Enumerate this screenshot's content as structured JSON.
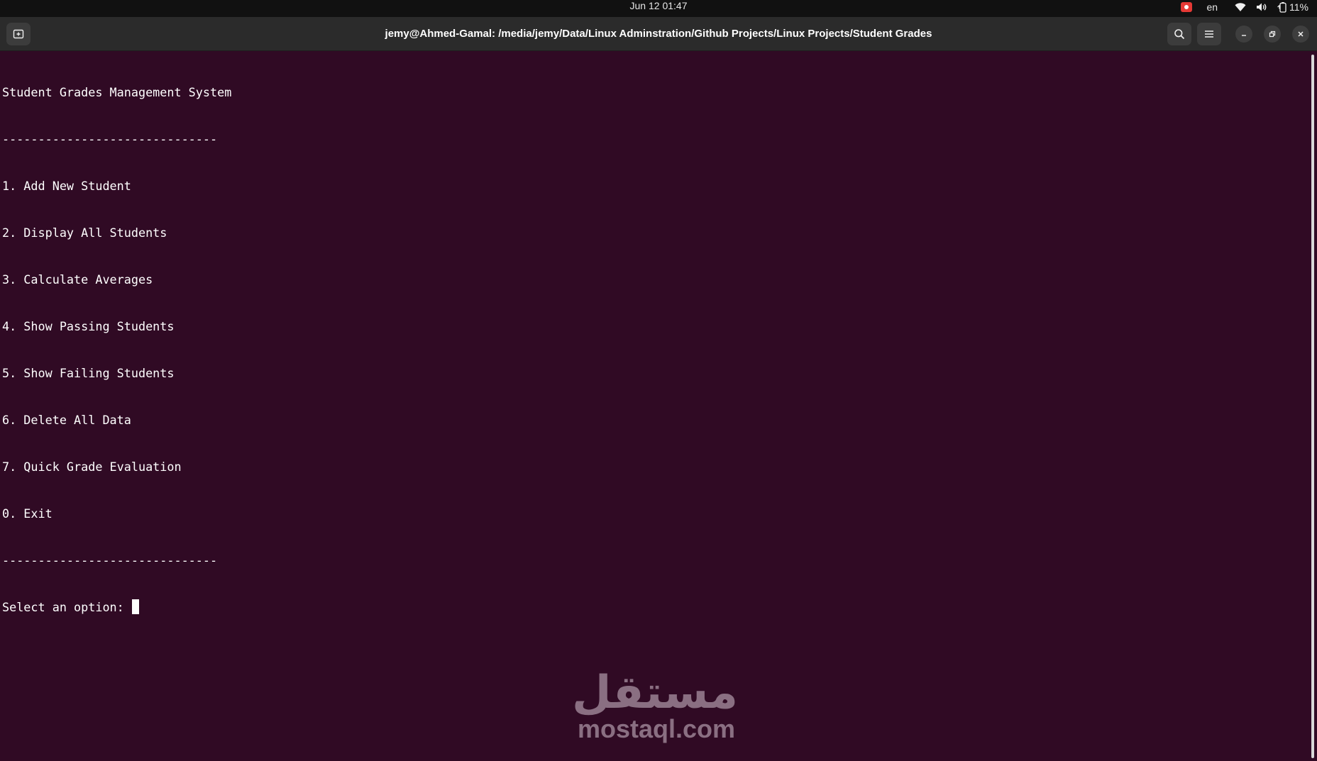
{
  "system_bar": {
    "clock": "Jun 12  01:47",
    "language": "en",
    "battery": "11%"
  },
  "window": {
    "title": "jemy@Ahmed-Gamal: /media/jemy/Data/Linux Adminstration/Github Projects/Linux Projects/Student Grades",
    "icons": [
      "new-tab-icon",
      "search-icon",
      "hamburger-menu-icon",
      "minimize-icon",
      "restore-icon",
      "close-icon"
    ]
  },
  "terminal": {
    "header": "Student Grades Management System",
    "separator_top": "------------------------------",
    "menu_items": [
      "1. Add New Student",
      "2. Display All Students",
      "3. Calculate Averages",
      "4. Show Passing Students",
      "5. Show Failing Students",
      "6. Delete All Data",
      "7. Quick Grade Evaluation",
      "0. Exit"
    ],
    "separator_bottom": "------------------------------",
    "prompt": "Select an option: "
  },
  "watermark": {
    "arabic": "مستقل",
    "url": "mostaql.com"
  },
  "colors": {
    "terminal_bg": "#300a24",
    "titlebar_bg": "#2b2b2b",
    "topbar_bg": "#111111",
    "text": "#ffffff",
    "record_indicator": "#e53935"
  }
}
